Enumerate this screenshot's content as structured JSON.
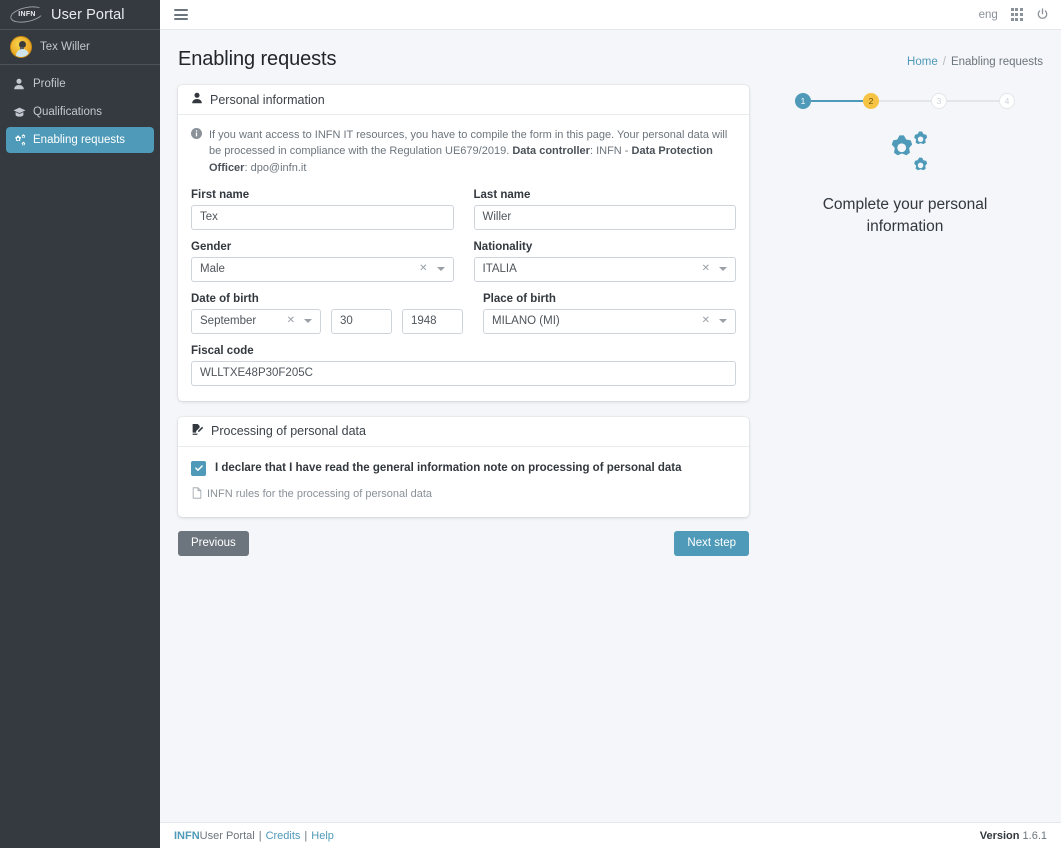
{
  "sidebar": {
    "brand": {
      "logo_text": "INFN",
      "title": "User Portal",
      "logo_icon": "infn-swoosh-logo"
    },
    "user": {
      "name": "Tex Willer",
      "avatar_icon": "user-avatar"
    },
    "items": [
      {
        "label": "Profile",
        "icon": "user-icon",
        "active": false
      },
      {
        "label": "Qualifications",
        "icon": "graduation-cap-icon",
        "active": false
      },
      {
        "label": "Enabling requests",
        "icon": "cogs-icon",
        "active": true
      }
    ]
  },
  "topbar": {
    "menu_icon": "hamburger-icon",
    "language": "eng",
    "apps_icon": "apps-grid-icon",
    "power_icon": "power-icon"
  },
  "page": {
    "title": "Enabling requests",
    "breadcrumb": {
      "home": "Home",
      "separator": "/",
      "current": "Enabling requests"
    }
  },
  "personal_information": {
    "header": "Personal information",
    "header_icon": "user-icon",
    "alert_icon": "info-circle-icon",
    "alert": {
      "part1": "If you want access to INFN IT resources, you have to compile the form in this page. Your personal data will be processed in compliance with the Regulation UE679/2019. ",
      "bold1": "Data controller",
      "part2": ": INFN - ",
      "bold2": "Data Protection Officer",
      "part3": ": dpo@infn.it"
    },
    "fields": {
      "first_name": {
        "label": "First name",
        "value": "Tex"
      },
      "last_name": {
        "label": "Last name",
        "value": "Willer"
      },
      "gender": {
        "label": "Gender",
        "value": "Male"
      },
      "nationality": {
        "label": "Nationality",
        "value": "ITALIA"
      },
      "date_of_birth": {
        "label": "Date of birth",
        "month": "September",
        "day": "30",
        "year": "1948"
      },
      "place_of_birth": {
        "label": "Place of birth",
        "value": "MILANO (MI)"
      },
      "fiscal_code": {
        "label": "Fiscal code",
        "value": "WLLTXE48P30F205C"
      }
    },
    "clear_icon": "clear-x-icon",
    "dropdown_icon": "chevron-down-icon"
  },
  "processing_personal_data": {
    "header": "Processing of personal data",
    "header_icon": "file-signature-icon",
    "declaration": "I declare that I have read the general information note on processing of personal data",
    "declaration_checked": true,
    "rules_link": "INFN rules for the processing of personal data",
    "rules_icon": "file-pdf-icon"
  },
  "buttons": {
    "previous": "Previous",
    "next": "Next step"
  },
  "wizard": {
    "steps": [
      {
        "number": "1",
        "state": "done"
      },
      {
        "number": "2",
        "state": "current"
      },
      {
        "number": "3",
        "state": "todo"
      },
      {
        "number": "4",
        "state": "todo"
      }
    ],
    "stage_icon": "cogs-icon",
    "stage_text": "Complete your personal information"
  },
  "footer": {
    "brand": "INFN",
    "portal": " User Portal",
    "sep1": "|",
    "credits": "Credits",
    "sep2": "|",
    "help": "Help",
    "version_label": "Version",
    "version_number": "1.6.1"
  },
  "colors": {
    "sidebar_bg": "#343a40",
    "accent": "#4e9ab8",
    "current_step": "#f6c344",
    "page_bg": "#f4f6f9",
    "secondary": "#6c757d"
  }
}
